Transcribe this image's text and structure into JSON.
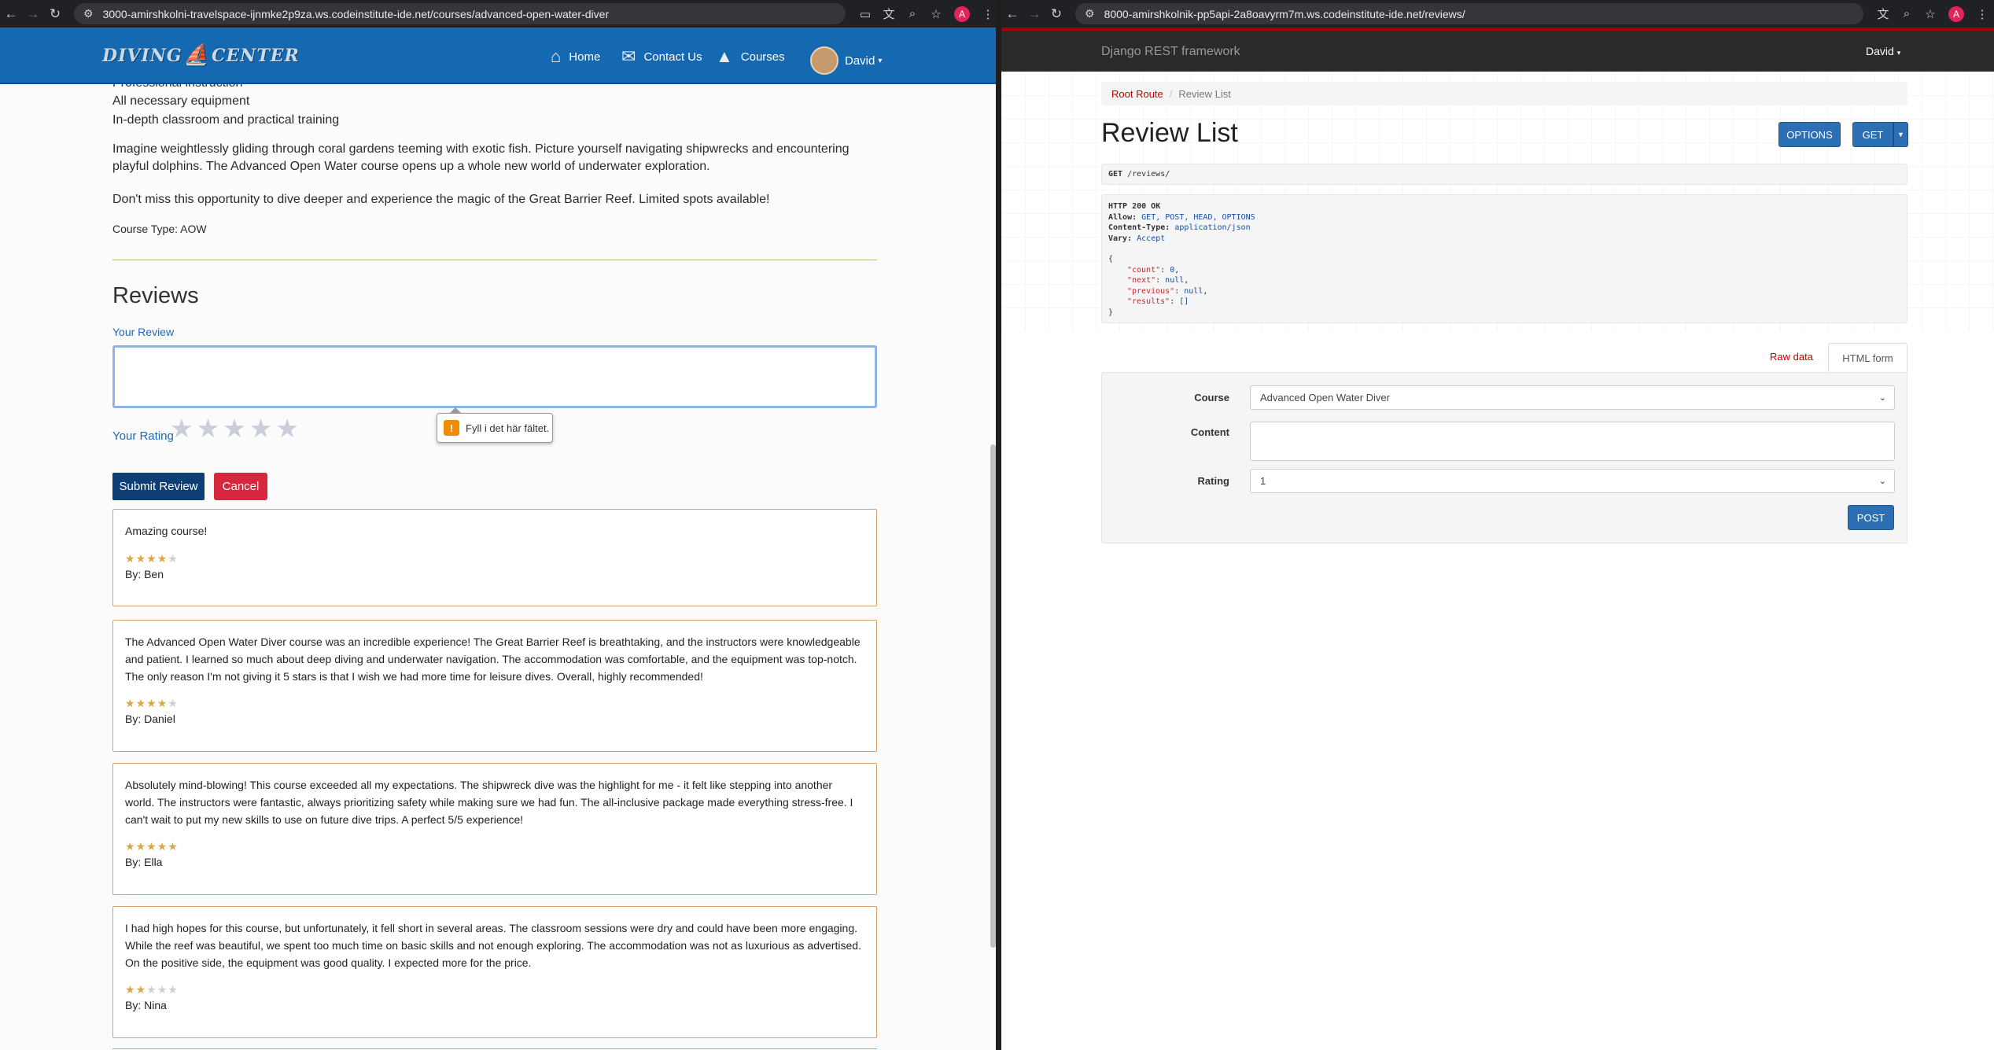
{
  "left_window": {
    "url": "3000-amirshkolni-travelspace-ijnmke2p9za.ws.codeinstitute-ide.net/courses/advanced-open-water-diver",
    "profile_letter": "A",
    "logo_left": "DIVING",
    "logo_right": "CENTER",
    "nav": {
      "home": "Home",
      "contact": "Contact Us",
      "courses": "Courses",
      "user": "David"
    },
    "list_items": [
      "Professional instruction",
      "All necessary equipment",
      "In-depth classroom and practical training"
    ],
    "para1": "Imagine weightlessly gliding through coral gardens teeming with exotic fish. Picture yourself navigating shipwrecks and encountering playful dolphins. The Advanced Open Water course opens up a whole new world of underwater exploration.",
    "para2": "Don't miss this opportunity to dive deeper and experience the magic of the Great Barrier Reef. Limited spots available!",
    "course_type": "Course Type: AOW",
    "reviews_heading": "Reviews",
    "your_review_label": "Your Review",
    "your_rating_label": "Your Rating",
    "tooltip": "Fyll i det här fältet.",
    "submit": "Submit Review",
    "cancel": "Cancel",
    "reviews": [
      {
        "text": "Amazing course!",
        "rating": 4,
        "by": "By: Ben"
      },
      {
        "text": "The Advanced Open Water Diver course was an incredible experience! The Great Barrier Reef is breathtaking, and the instructors were knowledgeable and patient. I learned so much about deep diving and underwater navigation. The accommodation was comfortable, and the equipment was top-notch. The only reason I'm not giving it 5 stars is that I wish we had more time for leisure dives. Overall, highly recommended!",
        "rating": 4,
        "by": "By: Daniel"
      },
      {
        "text": "Absolutely mind-blowing! This course exceeded all my expectations. The shipwreck dive was the highlight for me - it felt like stepping into another world. The instructors were fantastic, always prioritizing safety while making sure we had fun. The all-inclusive package made everything stress-free. I can't wait to put my new skills to use on future dive trips. A perfect 5/5 experience!",
        "rating": 5,
        "by": "By: Ella"
      },
      {
        "text": "I had high hopes for this course, but unfortunately, it fell short in several areas. The classroom sessions were dry and could have been more engaging. While the reef was beautiful, we spent too much time on basic skills and not enough exploring. The accommodation was not as luxurious as advertised. On the positive side, the equipment was good quality. I expected more for the price.",
        "rating": 2,
        "by": "By: Nina"
      }
    ]
  },
  "right_window": {
    "url": "8000-amirshkolnik-pp5api-2a8oavyrm7m.ws.codeinstitute-ide.net/reviews/",
    "profile_letter": "A",
    "brand": "Django REST framework",
    "user": "David",
    "breadcrumb_root": "Root Route",
    "breadcrumb_sep": "/",
    "breadcrumb_current": "Review List",
    "title": "Review List",
    "options_btn": "OPTIONS",
    "get_btn": "GET",
    "request_method": "GET",
    "request_path": "/reviews/",
    "response": {
      "status": "HTTP 200 OK",
      "allow_label": "Allow:",
      "allow_value": "GET, POST, HEAD, OPTIONS",
      "ct_label": "Content-Type:",
      "ct_value": "application/json",
      "vary_label": "Vary:",
      "vary_value": "Accept",
      "open": "{",
      "close": "}",
      "count_key": "\"count\"",
      "count_val": "0",
      "next_key": "\"next\"",
      "next_val": "null",
      "prev_key": "\"previous\"",
      "prev_val": "null",
      "results_key": "\"results\"",
      "results_val": "[]"
    },
    "tab_raw": "Raw data",
    "tab_html": "HTML form",
    "course_label": "Course",
    "course_value": "Advanced Open Water Diver",
    "content_label": "Content",
    "rating_label": "Rating",
    "rating_value": "1",
    "post_btn": "POST"
  }
}
